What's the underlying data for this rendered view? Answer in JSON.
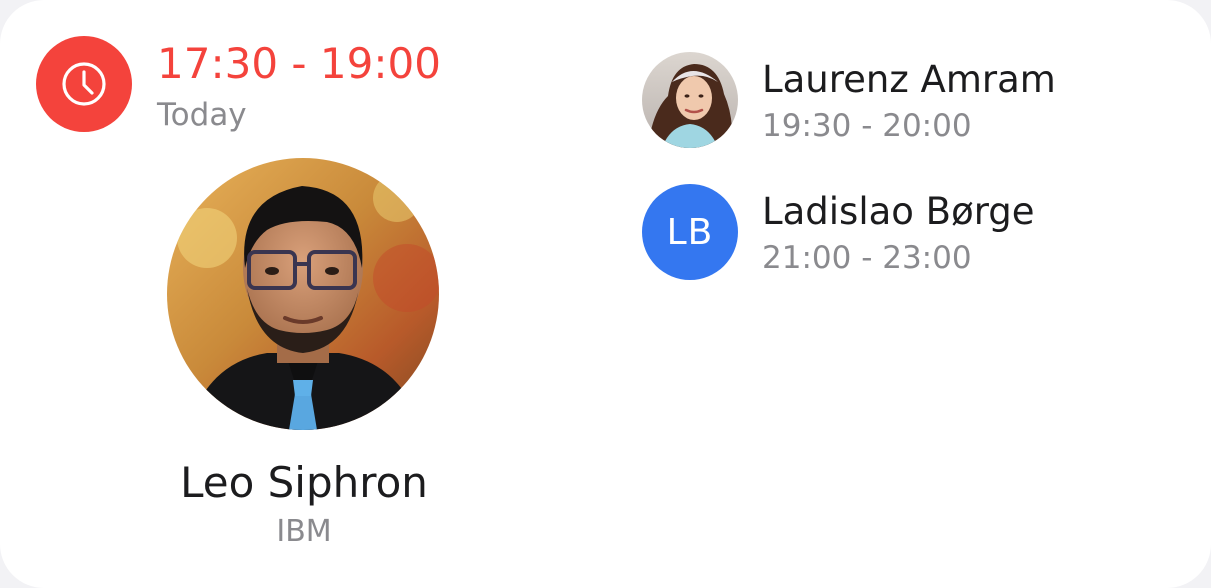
{
  "current": {
    "icon": "clock-icon",
    "time": "17:30 - 19:00",
    "day": "Today",
    "accent_color": "#f4433c"
  },
  "main_person": {
    "name": "Leo Siphron",
    "company": "IBM",
    "avatar": "person-photo"
  },
  "upcoming": [
    {
      "name": "Laurenz Amram",
      "time": "19:30 - 20:00",
      "avatar": "person-photo"
    },
    {
      "name": "Ladislao Børge",
      "time": "21:00 - 23:00",
      "initials": "LB",
      "avatar_color": "#3477f0"
    }
  ]
}
